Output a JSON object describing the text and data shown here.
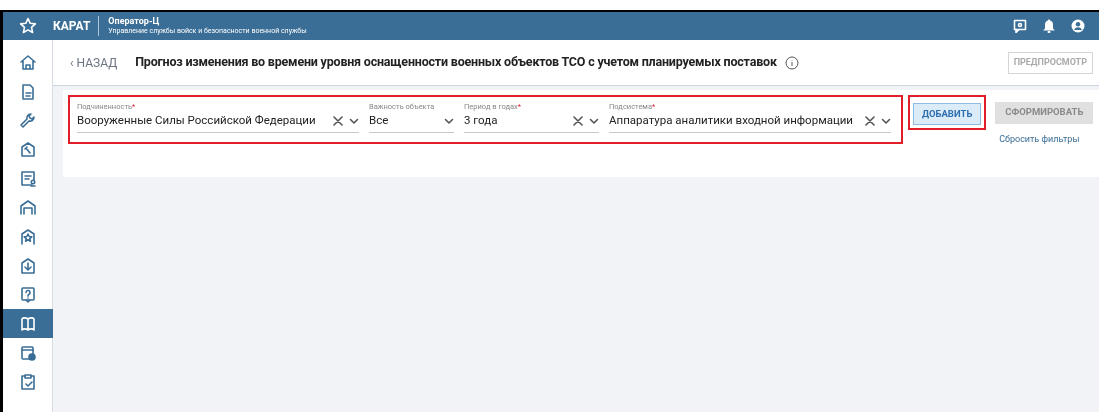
{
  "header": {
    "logo": "КАРАТ",
    "app_title": "Оператор-Ц",
    "app_subtitle": "Управление службы войск и безопасности военной службы"
  },
  "sidebar": {
    "items": [
      {
        "kind": "home",
        "selected": false
      },
      {
        "kind": "document",
        "selected": false
      },
      {
        "kind": "wrench",
        "selected": false
      },
      {
        "kind": "hammer",
        "selected": false
      },
      {
        "kind": "certificate",
        "selected": false
      },
      {
        "kind": "hangar",
        "selected": false
      },
      {
        "kind": "star",
        "selected": false
      },
      {
        "kind": "download",
        "selected": false
      },
      {
        "kind": "help",
        "selected": false
      },
      {
        "kind": "book",
        "selected": true
      },
      {
        "kind": "calendar",
        "selected": false
      },
      {
        "kind": "clipboard",
        "selected": false
      }
    ]
  },
  "page": {
    "back": "‹ НАЗАД",
    "title": "Прогноз изменения во времени уровня оснащенности военных объектов ТСО с учетом планируемых поставок",
    "preview_button": "ПРЕДПРОСМОТР"
  },
  "filters": {
    "highlighted": true,
    "required_mark": "*",
    "fields": [
      {
        "label": "Подчиненность",
        "required": true,
        "value": "Вооруженные Силы Российской Федерации",
        "clearable": true
      },
      {
        "label": "Важность объекта",
        "required": false,
        "value": "Все",
        "clearable": false
      },
      {
        "label": "Период в годах",
        "required": true,
        "value": "3 года",
        "clearable": true
      },
      {
        "label": "Подсистема",
        "required": true,
        "value": "Аппаратура аналитики входной информации",
        "clearable": true
      }
    ]
  },
  "actions": {
    "add_button": {
      "label": "ДОБАВИТЬ",
      "highlighted": true
    },
    "build_button": {
      "label": "СФОРМИРОВАТЬ",
      "disabled": true
    },
    "reset_link": "Сбросить фильтры"
  }
}
